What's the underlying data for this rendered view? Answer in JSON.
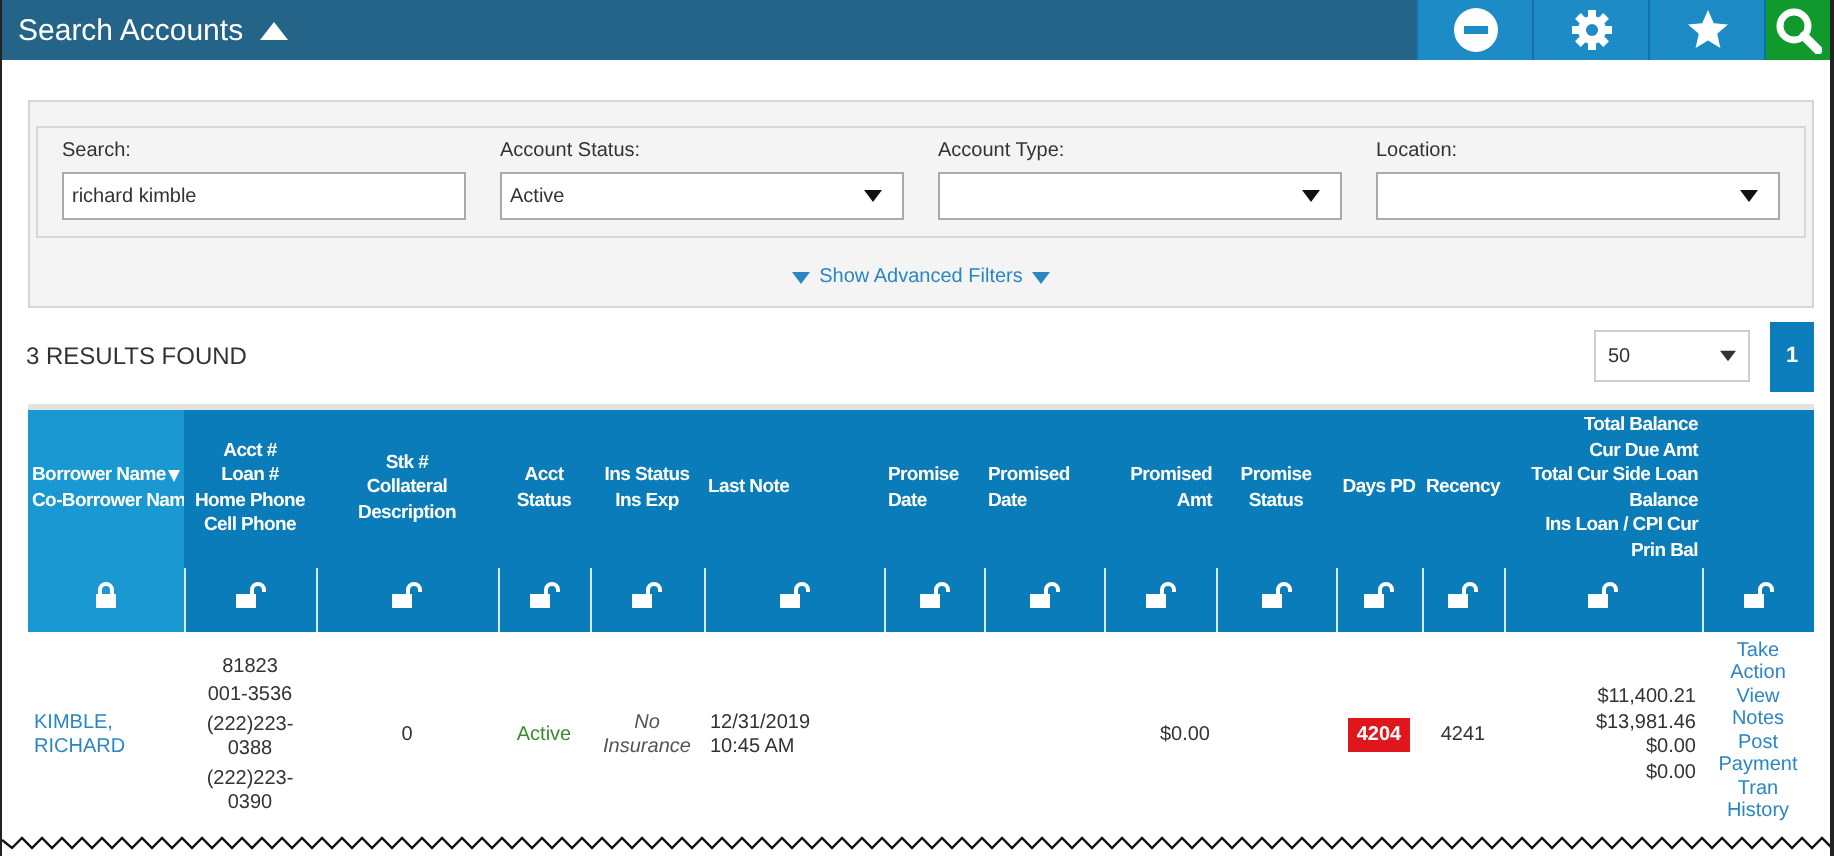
{
  "header": {
    "title": "Search Accounts",
    "buttons": [
      {
        "kind": "minus"
      },
      {
        "kind": "gear"
      },
      {
        "kind": "star"
      },
      {
        "kind": "search"
      }
    ]
  },
  "filters": {
    "fields": [
      {
        "label": "Search:",
        "kind": "text",
        "value": "richard kimble"
      },
      {
        "label": "Account Status:",
        "kind": "select",
        "value": "Active"
      },
      {
        "label": "Account Type:",
        "kind": "select"
      },
      {
        "label": "Location:",
        "kind": "select"
      }
    ],
    "advanced_link": "Show Advanced Filters"
  },
  "results": {
    "count_text": "3 RESULTS FOUND",
    "page_size": "50",
    "pages": [
      {
        "label": "1",
        "selected": true
      }
    ]
  },
  "table": {
    "columns": [
      {
        "label": "Borrower Name\nCo-Borrower Nam",
        "sorted": true,
        "locked": true
      },
      {
        "label": "Acct #\nLoan #\nHome Phone\nCell Phone",
        "sorted": false,
        "locked": false
      },
      {
        "label": "Stk #\nCollateral\nDescription",
        "sorted": false,
        "locked": false
      },
      {
        "label": "Acct\nStatus",
        "sorted": false,
        "locked": false
      },
      {
        "label": "Ins Status\nIns Exp",
        "sorted": false,
        "locked": false
      },
      {
        "label": "Last Note",
        "sorted": false,
        "locked": false
      },
      {
        "label": "Promise\nDate",
        "sorted": false,
        "locked": false
      },
      {
        "label": "Promised\nDate",
        "sorted": false,
        "locked": false
      },
      {
        "label": "Promised\nAmt",
        "sorted": false,
        "locked": false
      },
      {
        "label": "Promise\nStatus",
        "sorted": false,
        "locked": false
      },
      {
        "label": "Days PD",
        "sorted": false,
        "locked": false
      },
      {
        "label": "Recency",
        "sorted": false,
        "locked": false
      },
      {
        "label": "Total Balance\nCur Due Amt\nTotal Cur Side Loan\nBalance\nIns Loan / CPI Cur\nPrin Bal",
        "sorted": false,
        "locked": false
      },
      {
        "sorted": false,
        "locked": false
      }
    ],
    "rows": [
      {
        "borrower": "KIMBLE,\nRICHARD",
        "acct_lines": [
          "81823",
          "001-3536",
          "(222)223-\n0388",
          "(222)223-\n0390"
        ],
        "stk": "0",
        "acct_status": "Active",
        "ins_status": "No\nInsurance",
        "last_note": "12/31/2019\n10:45 AM",
        "promised_amt": "$0.00",
        "days_pd": "4204",
        "recency": "4241",
        "balances": [
          "$11,400.21",
          "$13,981.46",
          "$0.00",
          "$0.00"
        ],
        "actions": [
          "Take\nAction",
          "View\nNotes",
          "Post\nPayment",
          "Tran\nHistory"
        ]
      }
    ]
  }
}
